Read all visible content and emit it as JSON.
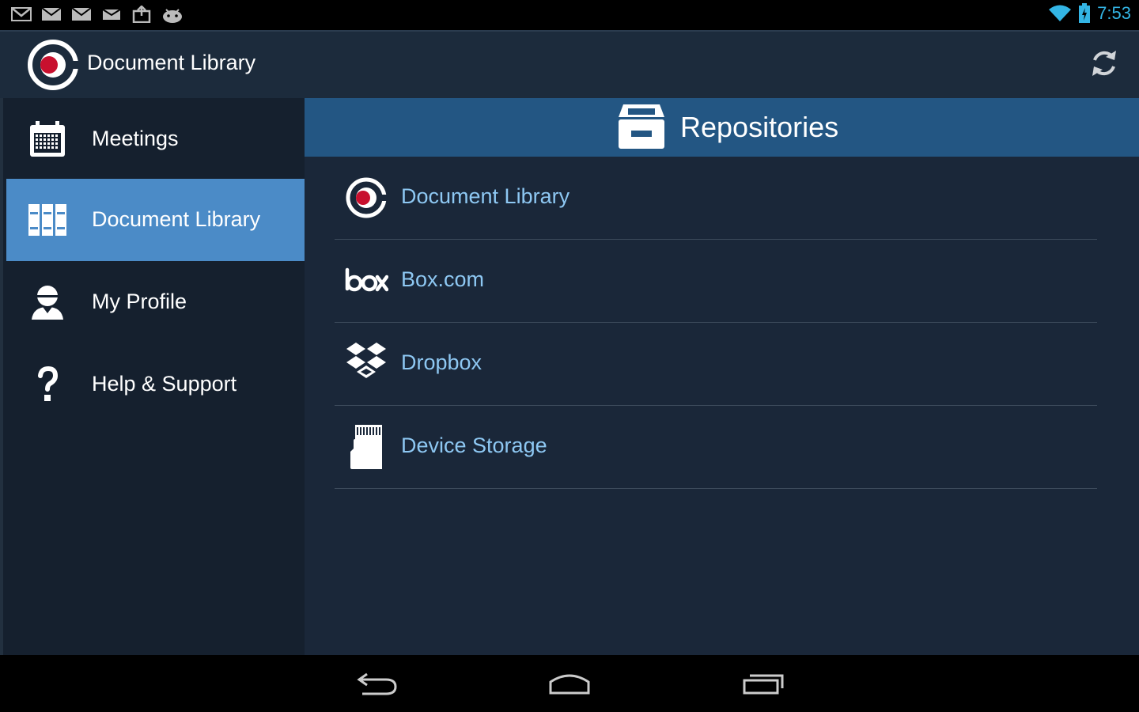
{
  "status_bar": {
    "time": "7:53",
    "notification_icons": [
      "gmail-icon",
      "mail-icon",
      "mail-icon",
      "mail-icon",
      "briefcase-upload-icon",
      "android-icon"
    ],
    "right_icons": [
      "wifi-icon",
      "battery-charging-icon"
    ]
  },
  "action_bar": {
    "title": "Document Library",
    "refresh_icon": "refresh-icon"
  },
  "sidebar": {
    "items": [
      {
        "label": "Meetings",
        "icon": "calendar-icon",
        "selected": false
      },
      {
        "label": "Document Library",
        "icon": "books-icon",
        "selected": true
      },
      {
        "label": "My Profile",
        "icon": "user-icon",
        "selected": false
      },
      {
        "label": "Help & Support",
        "icon": "question-icon",
        "selected": false
      }
    ]
  },
  "main": {
    "title": "Repositories",
    "repositories": [
      {
        "label": "Document Library",
        "icon": "app-logo-icon"
      },
      {
        "label": "Box.com",
        "icon": "box-logo-icon"
      },
      {
        "label": "Dropbox",
        "icon": "dropbox-icon"
      },
      {
        "label": "Device Storage",
        "icon": "sd-card-icon"
      }
    ]
  },
  "nav_bar": {
    "buttons": [
      "back-icon",
      "home-icon",
      "recents-icon"
    ]
  },
  "colors": {
    "accent_selected": "#4b8bc7",
    "header_blue": "#235683",
    "link_blue": "#8ec8f3",
    "clock_blue": "#33b5e5",
    "logo_red": "#c8102e"
  }
}
